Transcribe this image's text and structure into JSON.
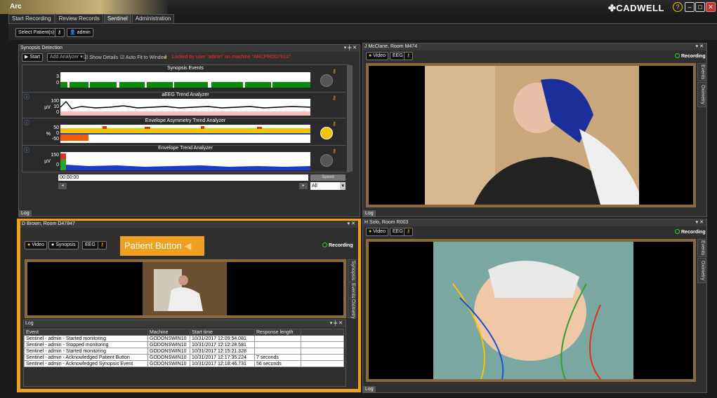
{
  "app": {
    "title": "Arc",
    "brand": "CADWELL"
  },
  "tabs": [
    "Start Recording",
    "Review Records",
    "Sentinel",
    "Administration"
  ],
  "toolbar": {
    "select_patients": "Select Patient(s)",
    "user": "admin"
  },
  "synopsis": {
    "title": "Synopsis Detection",
    "start": "Start",
    "add_analyzer": "Add Analyzer",
    "show_details": "Show Details",
    "auto_fit": "Auto Fit to Window",
    "locked_msg": "Locked by user \"admin\" on machine \"ARCPROD7010\"",
    "trends": [
      {
        "name": "Synopsis Events",
        "ticks": [
          "3",
          "0"
        ],
        "unit": ""
      },
      {
        "name": "aEEG Trend Analyzer",
        "ticks": [
          "100",
          "10",
          "0"
        ],
        "unit": "µV"
      },
      {
        "name": "Envelope Asymmetry Trend Analyzer",
        "ticks": [
          "50",
          "0",
          "-50"
        ],
        "unit": "%"
      },
      {
        "name": "Envelope Trend Analyzer",
        "ticks": [
          "150",
          "0"
        ],
        "unit": "µV"
      }
    ],
    "time": "00:00:00",
    "speed": "Speed",
    "filter": "All",
    "log": "Log"
  },
  "room1": {
    "title": "J McClane, Room M474",
    "video": "Video",
    "eeg": "EEG",
    "recording": "Recording",
    "side": [
      "Events",
      "Oximetry"
    ],
    "log": "Log"
  },
  "room2": {
    "title": "D Brown, Room D47847",
    "video": "Video",
    "synopsis": "Synopsis",
    "eeg": "EEG",
    "patient_button": "Patient Button",
    "recording": "Recording",
    "side": [
      "Synopsis",
      "Events",
      "Oximetry"
    ],
    "log_title": "Log",
    "columns": [
      "Event",
      "Machine",
      "Start time",
      "Response length"
    ],
    "rows": [
      [
        "Sentinel - admin - Started monitoring",
        "GODONSWIN10",
        "10/31/2017 12:09:54.081",
        ""
      ],
      [
        "Sentinel - admin - Stopped monitoring",
        "GODONSWIN10",
        "10/31/2017 12:12:28.581",
        ""
      ],
      [
        "Sentinel - admin - Started monitoring",
        "GODONSWIN10",
        "10/31/2017 12:15:21.328",
        ""
      ],
      [
        "Sentinel - admin - Acknowledged Patient Button",
        "GODONSWIN10",
        "10/31/2017 12:17:35.224",
        "7 seconds"
      ],
      [
        "Sentinel - admin - Acknowledged Synopsis Event",
        "GODONSWIN10",
        "10/31/2017 12:18:46.731",
        "56 seconds"
      ]
    ]
  },
  "room3": {
    "title": "H Solo, Room R003",
    "video": "Video",
    "eeg": "EEG",
    "recording": "Recording",
    "side": [
      "Events",
      "Oximetry"
    ],
    "log": "Log"
  },
  "colors": {
    "accent": "#f0a020",
    "frame": "#8a6a3a",
    "recording": "#33cc33",
    "locked": "#ff2a2a"
  }
}
